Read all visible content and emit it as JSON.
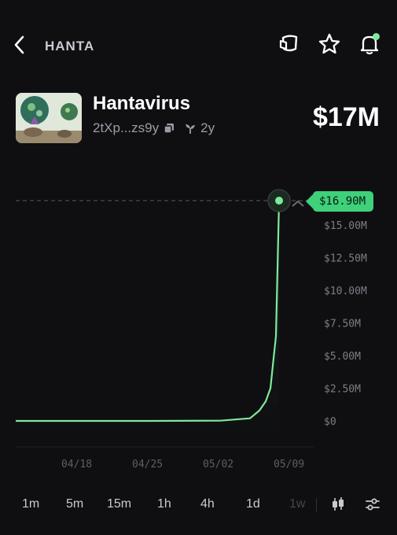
{
  "header": {
    "ticker": "HANTA",
    "icons": [
      "back-chevron-icon",
      "share-icon",
      "star-icon",
      "bell-icon"
    ],
    "notification_dot_color": "#7ee99a"
  },
  "token": {
    "name": "Hantavirus",
    "address": "2tXp...zs9y",
    "age": "2y",
    "market_cap": "$17M",
    "image_icon": "token-artwork"
  },
  "chart": {
    "current_price_label": "$16.90M",
    "accent_color": "#7ee99a",
    "y_ticks": [
      "$0",
      "$2.50M",
      "$5.00M",
      "$7.50M",
      "$10.00M",
      "$12.50M",
      "$15.00M"
    ],
    "x_ticks": [
      "04/18",
      "04/25",
      "05/02",
      "05/09"
    ]
  },
  "chart_data": {
    "type": "area",
    "x": [
      "04/11",
      "04/18",
      "04/25",
      "05/02",
      "05/04",
      "05/05",
      "05/06",
      "05/07",
      "05/08",
      "05/08",
      "05/09"
    ],
    "series": [
      {
        "values": [
          0,
          0,
          0,
          0.02,
          0.2,
          0.8,
          1.5,
          2.5,
          4.8,
          6.5,
          16.9
        ]
      }
    ],
    "ylim": [
      0,
      17
    ],
    "grid": false
  },
  "timeframes": {
    "items": [
      "1m",
      "5m",
      "15m",
      "1h",
      "4h",
      "1d",
      "1w"
    ],
    "disabled": [
      "1w"
    ],
    "tools": [
      "candlestick-icon",
      "settings-sliders-icon"
    ]
  }
}
